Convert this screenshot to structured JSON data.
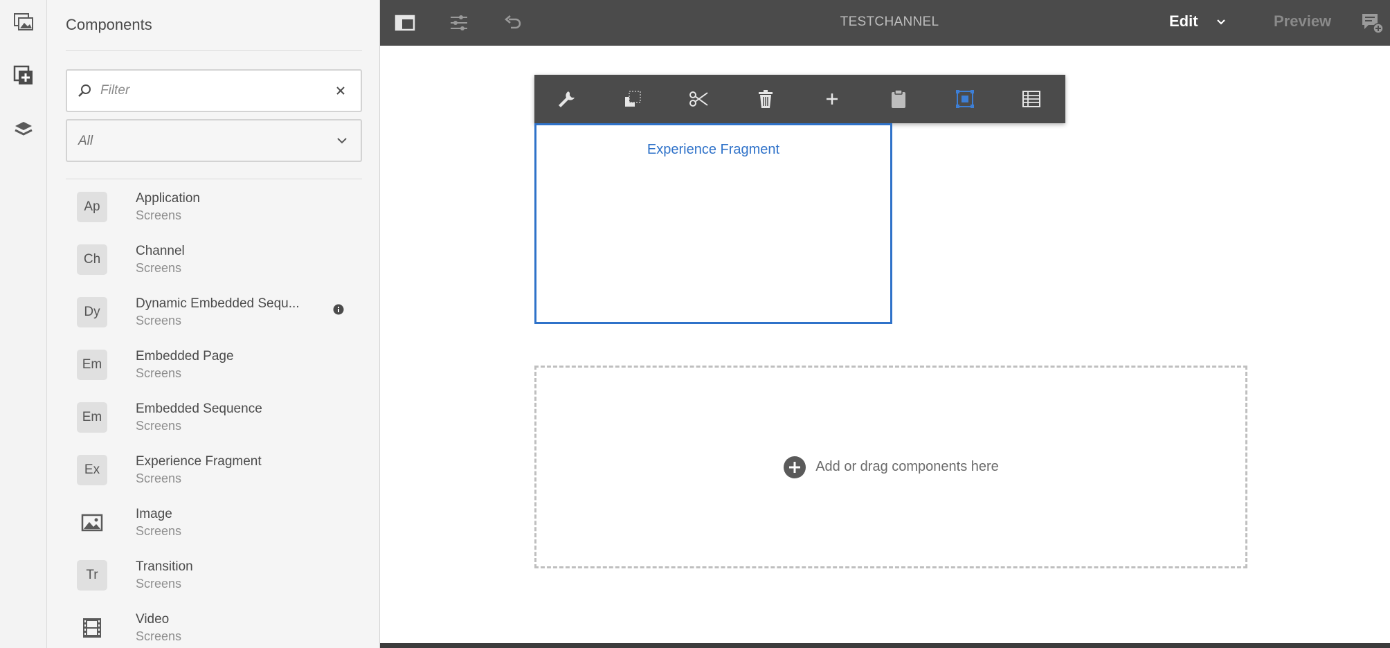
{
  "rail": {
    "items": [
      {
        "name": "assets-icon"
      },
      {
        "name": "components-icon"
      },
      {
        "name": "content-tree-icon"
      }
    ]
  },
  "panel": {
    "title": "Components",
    "filter": {
      "placeholder": "Filter",
      "value": ""
    },
    "group_select": {
      "value": "All"
    },
    "components": [
      {
        "badge": "Ap",
        "name": "Application",
        "group": "Screens"
      },
      {
        "badge": "Ch",
        "name": "Channel",
        "group": "Screens"
      },
      {
        "badge": "Dy",
        "name": "Dynamic Embedded Sequ...",
        "group": "Screens",
        "info": true
      },
      {
        "badge": "Em",
        "name": "Embedded Page",
        "group": "Screens"
      },
      {
        "badge": "Em",
        "name": "Embedded Sequence",
        "group": "Screens"
      },
      {
        "badge": "Ex",
        "name": "Experience Fragment",
        "group": "Screens"
      },
      {
        "badge": "",
        "icon": "image-icon",
        "name": "Image",
        "group": "Screens"
      },
      {
        "badge": "Tr",
        "name": "Transition",
        "group": "Screens"
      },
      {
        "badge": "",
        "icon": "video-icon",
        "name": "Video",
        "group": "Screens"
      }
    ]
  },
  "topbar": {
    "title": "TESTCHANNEL",
    "mode_edit": "Edit",
    "mode_preview": "Preview"
  },
  "canvas": {
    "fragment_label": "Experience Fragment",
    "dropzone_text": "Add or drag components here"
  },
  "colors": {
    "accent": "#2f72c9",
    "toolbar_bg": "#4b4b4b",
    "panel_bg": "#f5f5f5"
  }
}
